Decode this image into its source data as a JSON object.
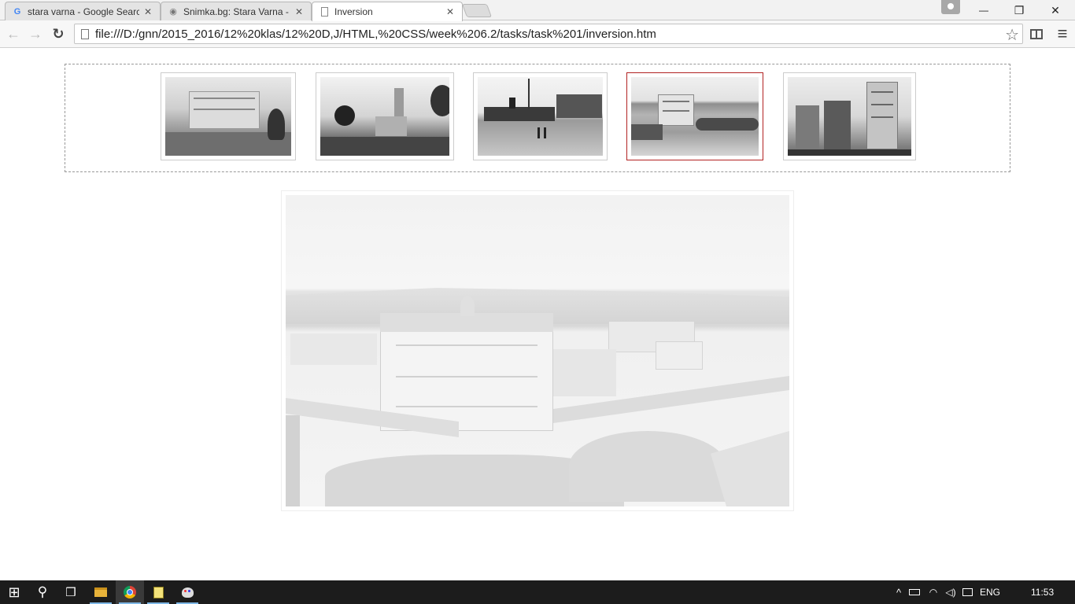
{
  "browser": {
    "tabs": [
      {
        "title": "stara varna - Google Searc",
        "favicon": "google-icon"
      },
      {
        "title": "Snimka.bg: Stara Varna - K",
        "favicon": "snimka-icon"
      },
      {
        "title": "Inversion",
        "favicon": "page-icon"
      }
    ],
    "url": "file:///D:/gnn/2015_2016/12%20klas/12%20D,J/HTML,%20CSS/week%206.2/tasks/task%201/inversion.htm",
    "close_glyph": "✕",
    "back_glyph": "←",
    "forward_glyph": "→",
    "reload_glyph": "↻",
    "star_glyph": "☆",
    "menu_glyph": "≡",
    "minimize_glyph": "—",
    "restore_glyph": "❐",
    "window_close_glyph": "✕"
  },
  "gallery": {
    "thumbnails": [
      {
        "name": "thumbnail-1",
        "selected": false
      },
      {
        "name": "thumbnail-2",
        "selected": false
      },
      {
        "name": "thumbnail-3",
        "selected": false
      },
      {
        "name": "thumbnail-4",
        "selected": true
      },
      {
        "name": "thumbnail-5",
        "selected": false
      }
    ],
    "selected_border_color": "#b22222"
  },
  "taskbar": {
    "start_glyph": "⊞",
    "search_glyph": "⚲",
    "task_view_glyph": "❒",
    "tray_up_glyph": "^",
    "language": "ENG",
    "time": "11:53"
  }
}
